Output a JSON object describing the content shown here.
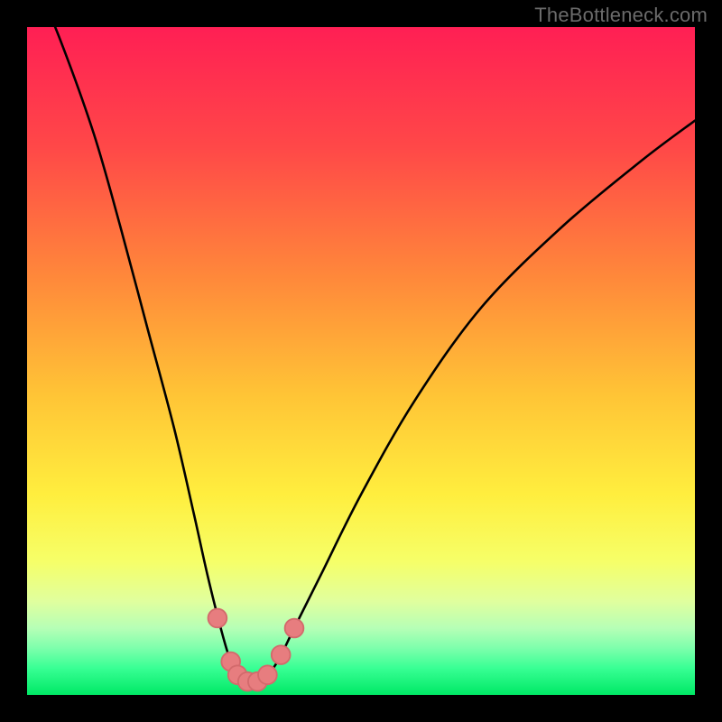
{
  "watermark": {
    "text": "TheBottleneck.com"
  },
  "colors": {
    "frame": "#000000",
    "curve": "#000000",
    "marker_fill": "#e77d7f",
    "marker_stroke": "#d36a6c",
    "grad_stops": [
      {
        "offset": "0%",
        "color": "#ff1f54"
      },
      {
        "offset": "18%",
        "color": "#ff4848"
      },
      {
        "offset": "38%",
        "color": "#ff8a3a"
      },
      {
        "offset": "55%",
        "color": "#ffc436"
      },
      {
        "offset": "70%",
        "color": "#ffee3e"
      },
      {
        "offset": "80%",
        "color": "#f6ff68"
      },
      {
        "offset": "86%",
        "color": "#e0ff9e"
      },
      {
        "offset": "90%",
        "color": "#b6ffb6"
      },
      {
        "offset": "93%",
        "color": "#7dffac"
      },
      {
        "offset": "96%",
        "color": "#38ff94"
      },
      {
        "offset": "100%",
        "color": "#00e865"
      }
    ]
  },
  "chart_data": {
    "type": "line",
    "title": "",
    "xlabel": "",
    "ylabel": "",
    "xlim": [
      0,
      100
    ],
    "ylim": [
      0,
      100
    ],
    "grid": false,
    "legend": false,
    "series": [
      {
        "name": "bottleneck-curve",
        "x": [
          0,
          5,
          10,
          14,
          18,
          22,
          25,
          27,
          29,
          30.5,
          32,
          33.5,
          35.5,
          37.5,
          40,
          44,
          50,
          58,
          68,
          80,
          92,
          100
        ],
        "values": [
          110,
          98,
          84,
          70,
          55,
          40,
          27,
          18,
          10,
          5,
          2.5,
          2,
          2.5,
          5,
          10,
          18,
          30,
          44,
          58,
          70,
          80,
          86
        ]
      }
    ],
    "markers": {
      "name": "highlight-points",
      "x": [
        28.5,
        30.5,
        31.5,
        33.0,
        34.5,
        36.0,
        38.0,
        40.0
      ],
      "values": [
        11.5,
        5.0,
        3.0,
        2.0,
        2.0,
        3.0,
        6.0,
        10.0
      ],
      "r": 1.4
    }
  }
}
